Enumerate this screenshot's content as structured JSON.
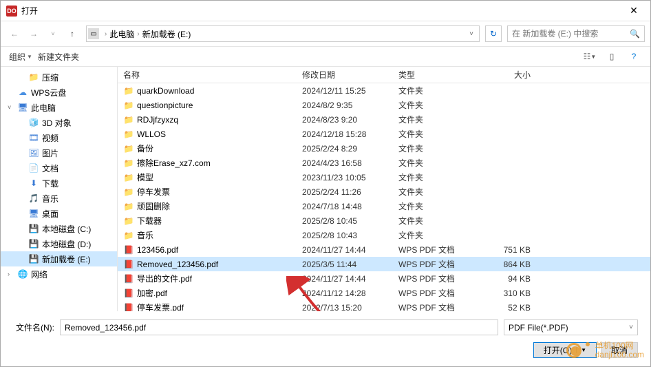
{
  "title": "打开",
  "breadcrumb": {
    "root": "此电脑",
    "drive": "新加载卷 (E:)"
  },
  "search": {
    "placeholder": "在 新加载卷 (E:) 中搜索"
  },
  "toolbar": {
    "organize": "组织",
    "newfolder": "新建文件夹"
  },
  "sidebar": {
    "items": [
      {
        "label": "压缩",
        "icon": "folder",
        "child": true
      },
      {
        "label": "WPS云盘",
        "icon": "wps",
        "child": false
      },
      {
        "label": "此电脑",
        "icon": "pc",
        "child": false,
        "exp": "˅"
      },
      {
        "label": "3D 对象",
        "icon": "obj3d",
        "child": true
      },
      {
        "label": "视频",
        "icon": "video",
        "child": true
      },
      {
        "label": "图片",
        "icon": "pic",
        "child": true
      },
      {
        "label": "文档",
        "icon": "doc",
        "child": true
      },
      {
        "label": "下载",
        "icon": "download",
        "child": true
      },
      {
        "label": "音乐",
        "icon": "music",
        "child": true
      },
      {
        "label": "桌面",
        "icon": "desktop",
        "child": true
      },
      {
        "label": "本地磁盘 (C:)",
        "icon": "drive",
        "child": true
      },
      {
        "label": "本地磁盘 (D:)",
        "icon": "drive",
        "child": true
      },
      {
        "label": "新加载卷 (E:)",
        "icon": "drive",
        "child": true,
        "selected": true
      },
      {
        "label": "网络",
        "icon": "net",
        "child": false,
        "exp": "›"
      }
    ]
  },
  "columns": {
    "name": "名称",
    "date": "修改日期",
    "type": "类型",
    "size": "大小"
  },
  "files": [
    {
      "name": "quarkDownload",
      "date": "2024/12/11 15:25",
      "type": "文件夹",
      "size": "",
      "icon": "folder"
    },
    {
      "name": "questionpicture",
      "date": "2024/8/2 9:35",
      "type": "文件夹",
      "size": "",
      "icon": "folder"
    },
    {
      "name": "RDJjfzyxzq",
      "date": "2024/8/23 9:20",
      "type": "文件夹",
      "size": "",
      "icon": "folder"
    },
    {
      "name": "WLLOS",
      "date": "2024/12/18 15:28",
      "type": "文件夹",
      "size": "",
      "icon": "folder"
    },
    {
      "name": "备份",
      "date": "2025/2/24 8:29",
      "type": "文件夹",
      "size": "",
      "icon": "folder"
    },
    {
      "name": "擦除Erase_xz7.com",
      "date": "2024/4/23 16:58",
      "type": "文件夹",
      "size": "",
      "icon": "folder"
    },
    {
      "name": "模型",
      "date": "2023/11/23 10:05",
      "type": "文件夹",
      "size": "",
      "icon": "folder"
    },
    {
      "name": "停车发票",
      "date": "2025/2/24 11:26",
      "type": "文件夹",
      "size": "",
      "icon": "folder"
    },
    {
      "name": "顽固删除",
      "date": "2024/7/18 14:48",
      "type": "文件夹",
      "size": "",
      "icon": "folder"
    },
    {
      "name": "下载器",
      "date": "2025/2/8 10:45",
      "type": "文件夹",
      "size": "",
      "icon": "folder"
    },
    {
      "name": "音乐",
      "date": "2025/2/8 10:43",
      "type": "文件夹",
      "size": "",
      "icon": "folder"
    },
    {
      "name": "123456.pdf",
      "date": "2024/11/27 14:44",
      "type": "WPS PDF 文档",
      "size": "751 KB",
      "icon": "pdf"
    },
    {
      "name": "Removed_123456.pdf",
      "date": "2025/3/5 11:44",
      "type": "WPS PDF 文档",
      "size": "864 KB",
      "icon": "pdf",
      "selected": true
    },
    {
      "name": "导出的文件.pdf",
      "date": "2024/11/27 14:44",
      "type": "WPS PDF 文档",
      "size": "94 KB",
      "icon": "pdf"
    },
    {
      "name": "加密.pdf",
      "date": "2024/11/12 14:28",
      "type": "WPS PDF 文档",
      "size": "310 KB",
      "icon": "pdf"
    },
    {
      "name": "停车发票.pdf",
      "date": "2022/7/13 15:20",
      "type": "WPS PDF 文档",
      "size": "52 KB",
      "icon": "pdf"
    }
  ],
  "footer": {
    "filename_label": "文件名(N):",
    "filename_value": "Removed_123456.pdf",
    "filter": "PDF File(*.PDF)",
    "open": "打开(O)",
    "cancel": "取消"
  },
  "watermark": {
    "text1": "单机100网",
    "text2": "danji100.com"
  }
}
